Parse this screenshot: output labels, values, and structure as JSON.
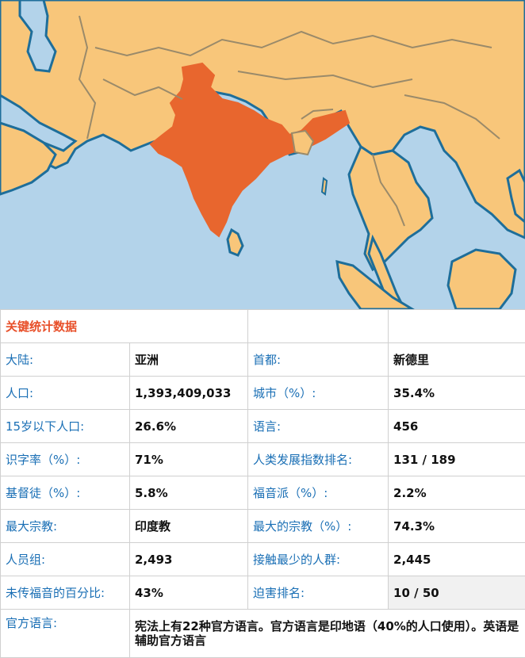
{
  "map": {
    "ocean_color": "#b3d3ea",
    "land_color": "#f8c67a",
    "highlight_color": "#e8662e",
    "border_color": "#1e6e9a",
    "highlighted_country": "印度"
  },
  "table": {
    "title": "关键统计数据",
    "rows": [
      {
        "l1": "大陆:",
        "v1": "亚洲",
        "l2": "首都:",
        "v2": "新德里"
      },
      {
        "l1": "人口:",
        "v1": "1,393,409,033",
        "l2": "城市（%）:",
        "v2": "35.4%"
      },
      {
        "l1": "15岁以下人口:",
        "v1": "26.6%",
        "l2": "语言:",
        "v2": "456"
      },
      {
        "l1": "识字率（%）:",
        "v1": "71%",
        "l2": "人类发展指数排名:",
        "v2": "131 / 189"
      },
      {
        "l1": "基督徒（%）:",
        "v1": "5.8%",
        "l2": "福音派（%）:",
        "v2": "2.2%"
      },
      {
        "l1": "最大宗教:",
        "v1": "印度教",
        "l2": "最大的宗教（%）:",
        "v2": "74.3%"
      },
      {
        "l1": "人员组:",
        "v1": "2,493",
        "l2": "接触最少的人群:",
        "v2": "2,445"
      },
      {
        "l1": "未传福音的百分比:",
        "v1": "43%",
        "l2": "迫害排名:",
        "v2": "10 / 50"
      }
    ],
    "official_language_label": "官方语言:",
    "official_language_value": "宪法上有22种官方语言。官方语言是印地语（40%的人口使用）。英语是辅助官方语言"
  }
}
